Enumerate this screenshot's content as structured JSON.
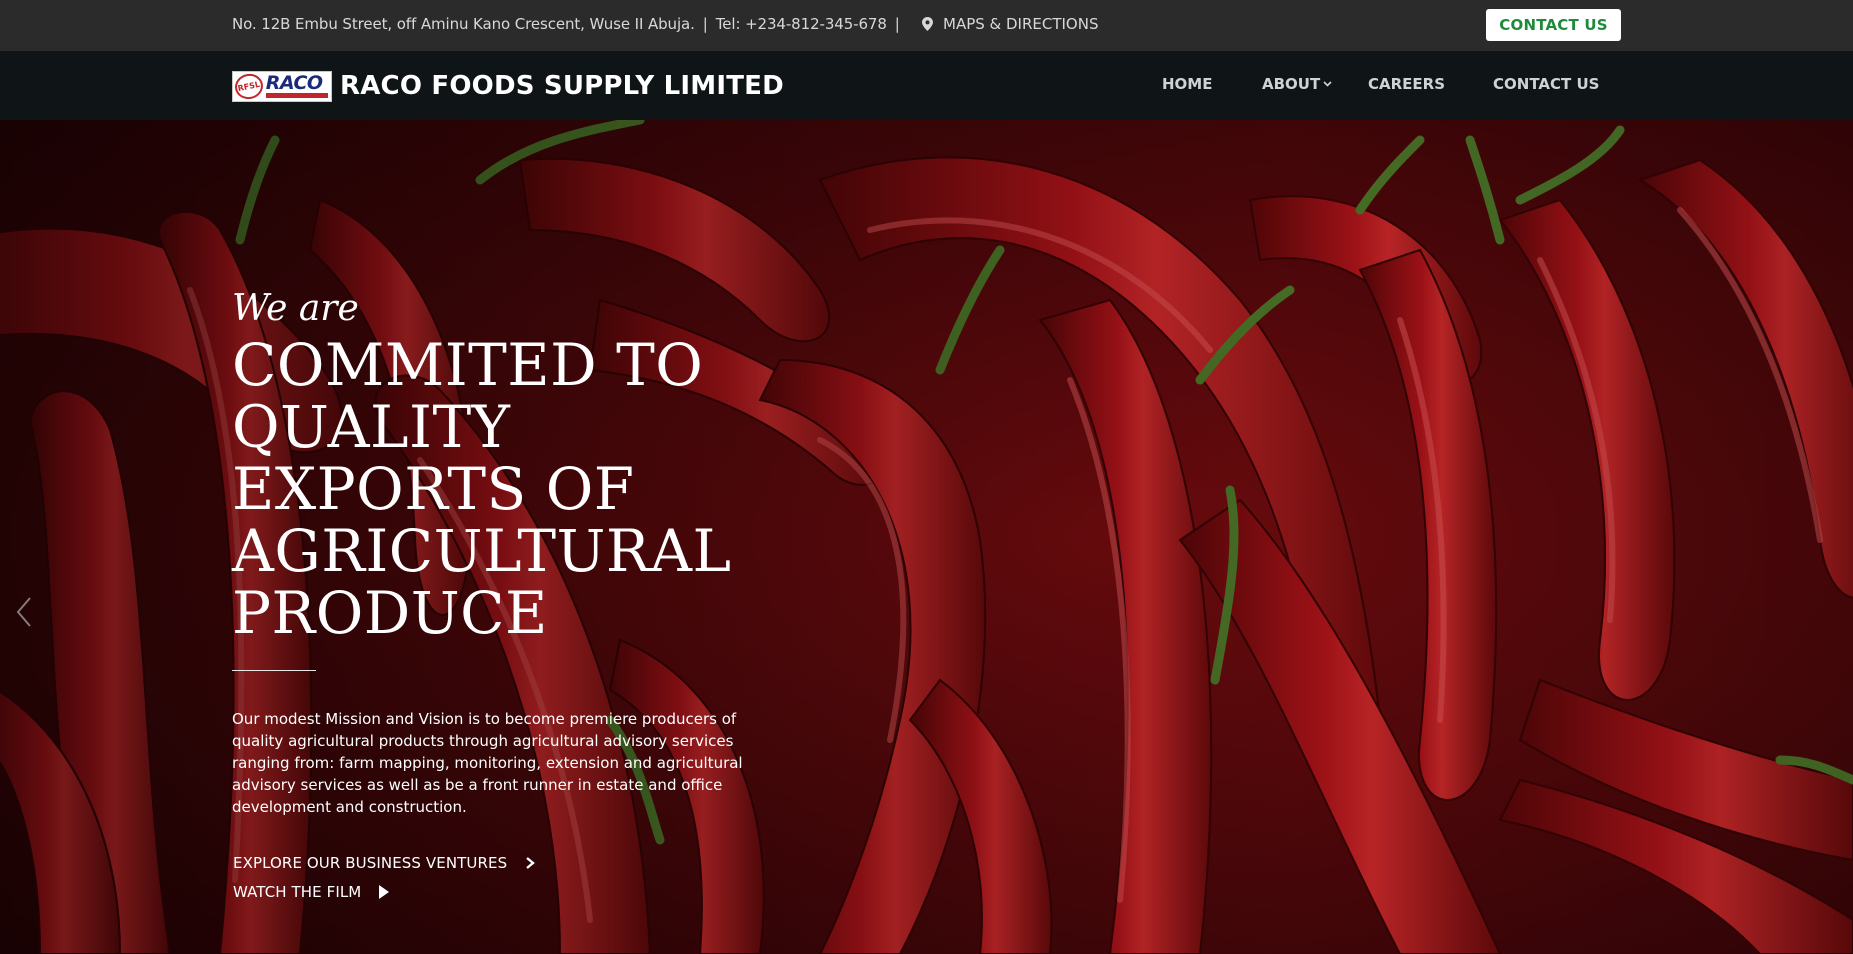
{
  "topbar": {
    "address": "No. 12B Embu Street, off Aminu Kano Crescent, Wuse II Abuja.",
    "separator": "|",
    "phone": "Tel: +234-812-345-678",
    "maps_label": "MAPS & DIRECTIONS",
    "contact_button": "CONTACT US",
    "contact_button_color": "#1f8a3c"
  },
  "navbar": {
    "logo": {
      "initials": "RFSL",
      "word": "RACO"
    },
    "brand_name": "RACO FOODS SUPPLY LIMITED",
    "links": [
      {
        "label": "HOME"
      },
      {
        "label": "ABOUT",
        "icon": "chevron-down-icon"
      },
      {
        "label": "CAREERS"
      },
      {
        "label": "CONTACT US"
      }
    ]
  },
  "hero": {
    "intro": "We are",
    "title_lines": [
      "COMMITED TO",
      "QUALITY",
      "EXPORTS OF",
      "AGRICULTURAL",
      "PRODUCE"
    ],
    "description": "Our modest Mission and Vision is to become premiere producers of quality agricultural products through agricultural advisory services ranging from: farm mapping, monitoring, extension and agricultural advisory services as well as be a front runner in estate and office development and construction.",
    "cta_primary": "EXPLORE OUR BUSINESS VENTURES",
    "cta_secondary": "WATCH THE FILM",
    "background": "red chili peppers",
    "prev_icon": "chevron-left-icon"
  }
}
